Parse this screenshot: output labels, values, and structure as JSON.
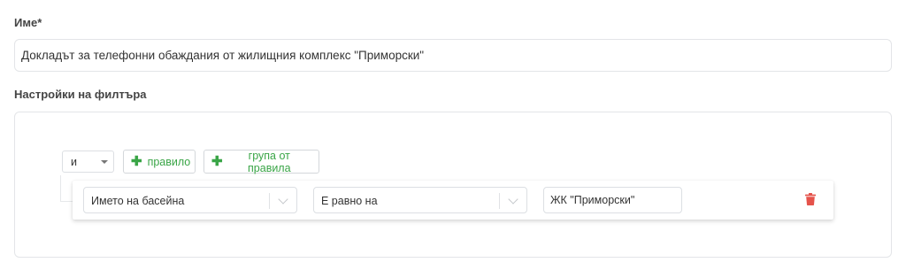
{
  "form": {
    "name_label": "Име*",
    "name_value": "Докладът за телефонни обаждания от жилищния комплекс \"Приморски\"",
    "filter_label": "Настройки на филтъра"
  },
  "query_builder": {
    "conjunction": "и",
    "add_rule_label": "правило",
    "add_group_label": "група от правила",
    "rules": [
      {
        "field": "Името на басейна",
        "operator": "Е равно на",
        "value": "ЖК \"Приморски\""
      }
    ]
  },
  "colors": {
    "add_button_text": "#3aa547",
    "delete_icon": "#e5534b"
  },
  "icons": [
    "plus-icon",
    "chevron-down-icon",
    "trash-icon"
  ]
}
